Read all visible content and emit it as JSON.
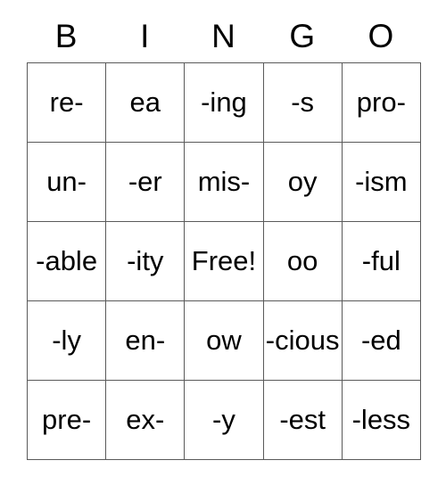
{
  "card": {
    "title": "BINGO",
    "headers": [
      "B",
      "I",
      "N",
      "G",
      "O"
    ],
    "free_space_label": "Free!",
    "colors": {
      "text": "#000000",
      "border": "#5a5a5a",
      "background": "#ffffff"
    },
    "rows": [
      [
        "re-",
        "ea",
        "-ing",
        "-s",
        "pro-"
      ],
      [
        "un-",
        "-er",
        "mis-",
        "oy",
        "-ism"
      ],
      [
        "-able",
        "-ity",
        "Free!",
        "oo",
        "-ful"
      ],
      [
        "-ly",
        "en-",
        "ow",
        "-cious",
        "-ed"
      ],
      [
        "pre-",
        "ex-",
        "-y",
        "-est",
        "-less"
      ]
    ]
  }
}
